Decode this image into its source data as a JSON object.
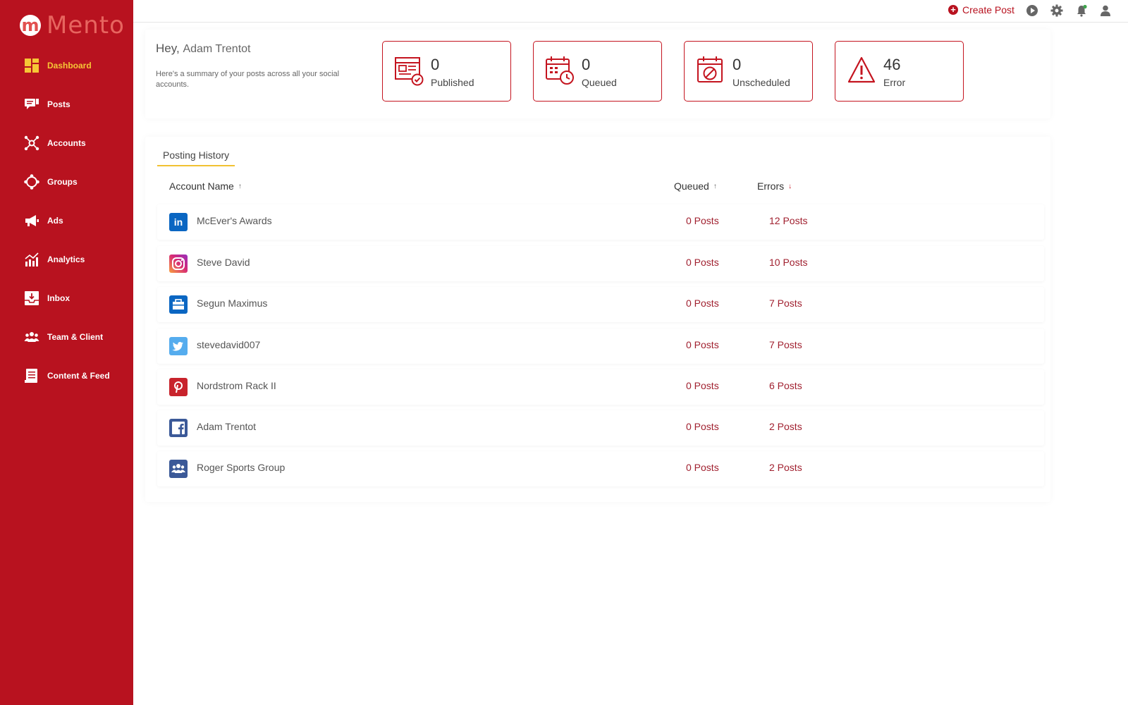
{
  "app": {
    "logo_mark": "m",
    "logo_text": "Mento"
  },
  "colors": {
    "brand": "#b8121f",
    "active_nav": "#f6c636",
    "accent_underline": "#f1c232",
    "posts_text": "#a01f2e"
  },
  "sidebar": {
    "items": [
      {
        "label": "Dashboard",
        "icon": "dashboard-icon",
        "active": true
      },
      {
        "label": "Posts",
        "icon": "posts-icon"
      },
      {
        "label": "Accounts",
        "icon": "accounts-icon"
      },
      {
        "label": "Groups",
        "icon": "groups-icon"
      },
      {
        "label": "Ads",
        "icon": "megaphone-icon"
      },
      {
        "label": "Analytics",
        "icon": "analytics-icon"
      },
      {
        "label": "Inbox",
        "icon": "inbox-icon"
      },
      {
        "label": "Team & Client",
        "icon": "team-icon"
      },
      {
        "label": "Content & Feed",
        "icon": "content-feed-icon"
      }
    ]
  },
  "topbar": {
    "create_post": "Create Post",
    "icons": [
      "play-icon",
      "settings-icon",
      "notification-bell-icon",
      "user-icon"
    ]
  },
  "summary": {
    "greeting": "Hey,",
    "user_name": "Adam Trentot",
    "subtitle": "Here's a summary of your posts across all your social accounts.",
    "stats": [
      {
        "value": "0",
        "label": "Published",
        "icon": "published-icon"
      },
      {
        "value": "0",
        "label": "Queued",
        "icon": "queued-calendar-icon"
      },
      {
        "value": "0",
        "label": "Unscheduled",
        "icon": "unscheduled-calendar-icon"
      },
      {
        "value": "46",
        "label": "Error",
        "icon": "warning-icon"
      }
    ]
  },
  "history": {
    "tab": "Posting History",
    "columns": {
      "account_name": "Account Name",
      "account_name_sort": "↑",
      "queued": "Queued",
      "queued_sort": "↑",
      "errors": "Errors",
      "errors_sort": "↓"
    },
    "rows": [
      {
        "name": "McEver's Awards",
        "queued": "0 Posts",
        "errors": "12 Posts",
        "network": "linkedin-icon"
      },
      {
        "name": "Steve David",
        "queued": "0 Posts",
        "errors": "10 Posts",
        "network": "instagram-icon"
      },
      {
        "name": "Segun Maximus",
        "queued": "0 Posts",
        "errors": "7 Posts",
        "network": "linkedin-page-icon"
      },
      {
        "name": "stevedavid007",
        "queued": "0 Posts",
        "errors": "7 Posts",
        "network": "twitter-icon"
      },
      {
        "name": "Nordstrom Rack II",
        "queued": "0 Posts",
        "errors": "6 Posts",
        "network": "pinterest-icon"
      },
      {
        "name": "Adam Trentot",
        "queued": "0 Posts",
        "errors": "2 Posts",
        "network": "facebook-icon"
      },
      {
        "name": "Roger Sports Group",
        "queued": "0 Posts",
        "errors": "2 Posts",
        "network": "facebook-group-icon"
      }
    ]
  }
}
